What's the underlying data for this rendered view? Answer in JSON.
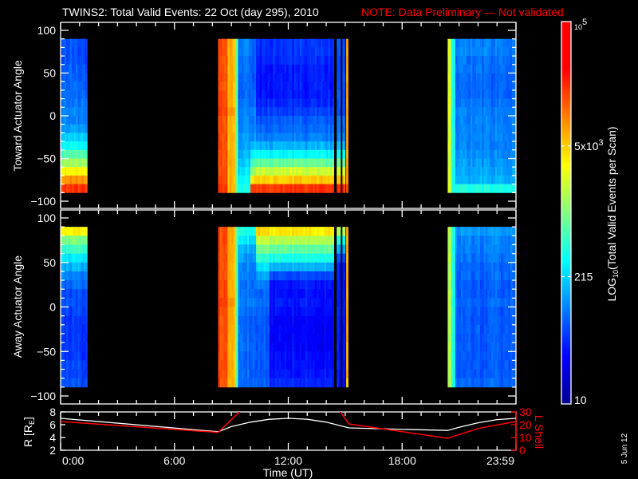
{
  "title": "TWINS2: Total Valid Events: 22 Oct (day 295), 2010",
  "note": "NOTE: Data Preliminary — Not validated",
  "date_stamp": "5 Jun 12",
  "colors": {
    "note": "#ff0000",
    "axis": "#ffffff",
    "lshell": "#ff0000",
    "radius": "#ffffff",
    "background": "#000000"
  },
  "chart_data": {
    "type": "heatmap",
    "x_range_hours": [
      0,
      24
    ],
    "x_ticks": [
      {
        "h": 0,
        "label": "0:00"
      },
      {
        "h": 6,
        "label": "6:00"
      },
      {
        "h": 12,
        "label": "12:00"
      },
      {
        "h": 18,
        "label": "18:00"
      },
      {
        "h": 24,
        "label": "23:59"
      }
    ],
    "xlabel": "Time (UT)",
    "angle_bins_deg": [
      85,
      75,
      65,
      55,
      45,
      35,
      25,
      15,
      5,
      -5,
      -15,
      -25,
      -35,
      -45,
      -55,
      -65,
      -75,
      -85
    ],
    "y_range": [
      -110,
      110
    ],
    "y_ticks": [
      "100",
      "50",
      "0",
      "−50",
      "−100"
    ],
    "y_tick_values": [
      100,
      50,
      0,
      -50,
      -100
    ],
    "value_units": "log10(Total Valid Events per Scan)",
    "panels": [
      {
        "ylabel": "Toward Actuator Angle",
        "columns": [
          {
            "t": [
              0,
              1.4
            ],
            "log_counts": [
              1.8,
              1.8,
              1.8,
              1.85,
              1.85,
              1.9,
              1.9,
              1.95,
              2.0,
              2.0,
              2.1,
              2.3,
              2.5,
              2.8,
              3.1,
              3.5,
              3.9,
              4.3
            ]
          },
          {
            "t": [
              8.3,
              8.8
            ],
            "log_counts": [
              4.2,
              4.2,
              4.2,
              4.2,
              4.2,
              4.2,
              4.2,
              4.2,
              4.25,
              4.2,
              4.2,
              4.2,
              4.2,
              4.2,
              4.2,
              4.2,
              4.2,
              4.3
            ]
          },
          {
            "t": [
              8.8,
              9.2
            ],
            "log_counts": [
              3.8,
              3.8,
              3.8,
              3.8,
              3.8,
              3.8,
              3.8,
              3.8,
              3.9,
              3.8,
              3.8,
              3.8,
              3.8,
              3.8,
              3.8,
              3.8,
              3.8,
              3.8
            ]
          },
          {
            "t": [
              9.2,
              9.35
            ],
            "log_counts": [
              2.9,
              2.9,
              2.9,
              2.9,
              2.9,
              2.9,
              2.9,
              2.9,
              2.9,
              2.9,
              2.9,
              2.9,
              2.9,
              2.9,
              2.9,
              2.9,
              2.9,
              2.9
            ]
          },
          {
            "t": [
              9.35,
              10.0
            ],
            "log_counts": [
              2.0,
              2.0,
              1.95,
              1.95,
              1.9,
              1.9,
              1.9,
              1.95,
              2.0,
              2.0,
              2.05,
              2.1,
              2.15,
              2.2,
              2.3,
              2.4,
              2.5,
              2.6
            ]
          },
          {
            "t": [
              10.0,
              10.3
            ],
            "log_counts": [
              1.9,
              1.9,
              1.85,
              1.85,
              1.85,
              1.85,
              1.9,
              1.9,
              2.0,
              2.0,
              2.05,
              2.1,
              2.2,
              2.5,
              2.8,
              3.1,
              3.6,
              4.3
            ]
          },
          {
            "t": [
              10.3,
              14.4
            ],
            "log_counts": [
              1.7,
              1.7,
              1.65,
              1.6,
              1.6,
              1.6,
              1.6,
              1.65,
              1.75,
              1.85,
              1.9,
              2.0,
              2.2,
              2.5,
              2.9,
              3.3,
              3.7,
              4.3
            ]
          },
          {
            "t": [
              14.55,
              14.75
            ],
            "log_counts": [
              1.8,
              1.8,
              1.8,
              1.8,
              1.8,
              1.8,
              1.8,
              1.8,
              1.8,
              1.9,
              1.9,
              2.0,
              2.2,
              2.5,
              2.9,
              3.3,
              3.7,
              4.3
            ]
          },
          {
            "t": [
              14.85,
              15.0
            ],
            "log_counts": [
              1.8,
              1.8,
              1.8,
              1.8,
              1.8,
              1.8,
              1.8,
              1.8,
              1.8,
              1.9,
              1.9,
              2.0,
              2.2,
              2.5,
              2.9,
              3.3,
              3.7,
              4.3
            ]
          },
          {
            "t": [
              15.05,
              15.15
            ],
            "log_counts": [
              3.8,
              3.8,
              3.8,
              3.8,
              3.8,
              3.8,
              3.8,
              3.8,
              3.8,
              3.8,
              3.8,
              3.8,
              3.8,
              3.8,
              3.8,
              3.8,
              3.8,
              4.2
            ]
          },
          {
            "t": [
              20.4,
              20.6
            ],
            "log_counts": [
              3.3,
              3.3,
              3.3,
              3.3,
              3.3,
              3.3,
              3.3,
              3.3,
              3.3,
              3.3,
              3.3,
              3.3,
              3.3,
              3.3,
              3.3,
              3.3,
              3.3,
              3.3
            ]
          },
          {
            "t": [
              20.6,
              20.8
            ],
            "log_counts": [
              2.6,
              2.6,
              2.6,
              2.6,
              2.6,
              2.6,
              2.6,
              2.6,
              2.6,
              2.6,
              2.6,
              2.6,
              2.6,
              2.6,
              2.6,
              2.6,
              2.6,
              2.6
            ]
          },
          {
            "t": [
              20.8,
              24.0
            ],
            "log_counts": [
              2.0,
              2.0,
              1.95,
              1.95,
              1.9,
              1.9,
              1.9,
              1.95,
              2.0,
              2.0,
              2.0,
              2.0,
              2.0,
              2.05,
              2.1,
              2.15,
              2.2,
              2.6
            ]
          }
        ]
      },
      {
        "ylabel": "Away Actuator Angle",
        "columns": [
          {
            "t": [
              0,
              1.4
            ],
            "log_counts": [
              3.5,
              3.0,
              2.7,
              2.4,
              2.2,
              2.0,
              1.9,
              1.8,
              1.8,
              1.75,
              1.7,
              1.7,
              1.7,
              1.7,
              1.7,
              1.75,
              1.75,
              1.8
            ]
          },
          {
            "t": [
              8.3,
              8.8
            ],
            "log_counts": [
              4.2,
              4.2,
              4.2,
              4.2,
              4.2,
              4.2,
              4.2,
              4.2,
              4.25,
              4.2,
              4.2,
              4.2,
              4.2,
              4.2,
              4.2,
              4.2,
              4.2,
              4.2
            ]
          },
          {
            "t": [
              8.8,
              9.2
            ],
            "log_counts": [
              3.8,
              3.8,
              3.8,
              3.8,
              3.8,
              3.8,
              3.8,
              3.8,
              3.9,
              3.8,
              3.8,
              3.8,
              3.8,
              3.8,
              3.8,
              3.8,
              3.8,
              3.8
            ]
          },
          {
            "t": [
              9.2,
              9.35
            ],
            "log_counts": [
              2.9,
              2.9,
              2.9,
              2.9,
              2.9,
              2.9,
              2.9,
              2.9,
              2.9,
              2.9,
              2.9,
              2.9,
              2.9,
              2.9,
              2.9,
              2.9,
              2.9,
              2.9
            ]
          },
          {
            "t": [
              9.35,
              10.3
            ],
            "log_counts": [
              2.6,
              2.4,
              2.2,
              2.1,
              2.0,
              2.0,
              1.95,
              1.95,
              2.0,
              1.95,
              1.9,
              1.9,
              1.9,
              1.9,
              1.9,
              1.9,
              1.9,
              1.9
            ]
          },
          {
            "t": [
              10.3,
              11.0
            ],
            "log_counts": [
              3.7,
              3.3,
              3.0,
              2.7,
              2.4,
              2.2,
              2.0,
              1.9,
              1.95,
              1.9,
              1.85,
              1.85,
              1.85,
              1.85,
              1.85,
              1.85,
              1.85,
              1.9
            ]
          },
          {
            "t": [
              11.0,
              14.4
            ],
            "log_counts": [
              3.6,
              3.2,
              2.9,
              2.6,
              2.2,
              1.8,
              1.6,
              1.55,
              1.6,
              1.55,
              1.5,
              1.5,
              1.5,
              1.5,
              1.55,
              1.55,
              1.6,
              1.65
            ]
          },
          {
            "t": [
              14.55,
              14.75
            ],
            "log_counts": [
              3.2,
              2.6,
              2.2,
              1.8,
              1.6,
              1.6,
              1.6,
              1.6,
              1.6,
              1.6,
              1.6,
              1.6,
              1.6,
              1.6,
              1.6,
              1.6,
              1.6,
              1.6
            ]
          },
          {
            "t": [
              14.85,
              15.0
            ],
            "log_counts": [
              3.2,
              2.6,
              2.2,
              1.8,
              1.6,
              1.6,
              1.6,
              1.6,
              1.6,
              1.6,
              1.6,
              1.6,
              1.6,
              1.6,
              1.6,
              1.6,
              1.6,
              1.6
            ]
          },
          {
            "t": [
              15.05,
              15.15
            ],
            "log_counts": [
              3.8,
              3.8,
              3.8,
              3.8,
              3.8,
              3.8,
              3.8,
              3.8,
              3.8,
              3.8,
              3.8,
              3.8,
              3.8,
              3.8,
              3.8,
              3.8,
              3.8,
              3.6
            ]
          },
          {
            "t": [
              20.4,
              20.6
            ],
            "log_counts": [
              3.2,
              3.2,
              3.2,
              3.2,
              3.2,
              3.2,
              3.2,
              3.2,
              3.2,
              3.2,
              3.2,
              3.2,
              3.2,
              3.2,
              3.2,
              3.2,
              3.2,
              3.2
            ]
          },
          {
            "t": [
              20.6,
              20.8
            ],
            "log_counts": [
              2.6,
              2.6,
              2.6,
              2.6,
              2.6,
              2.6,
              2.6,
              2.6,
              2.6,
              2.6,
              2.6,
              2.6,
              2.6,
              2.6,
              2.6,
              2.6,
              2.6,
              2.6
            ]
          },
          {
            "t": [
              20.8,
              24.0
            ],
            "log_counts": [
              2.1,
              2.0,
              2.0,
              1.95,
              1.9,
              1.9,
              1.85,
              1.85,
              1.9,
              1.85,
              1.85,
              1.85,
              1.85,
              1.85,
              1.85,
              1.85,
              1.85,
              1.9
            ]
          }
        ]
      }
    ],
    "colorbar": {
      "range_log10": [
        1,
        5
      ],
      "ticks": [
        {
          "log": 5,
          "base": "10",
          "exp": "5"
        },
        {
          "log": 3.699,
          "base": "5x10",
          "exp": "3"
        },
        {
          "log": 2.332,
          "base": "215",
          "exp": ""
        },
        {
          "log": 1,
          "base": "10",
          "exp": ""
        }
      ],
      "title_prefix": "LOG",
      "title_sub": "10",
      "title_rest": "(Total Valid Events per Scan)"
    },
    "orbit": {
      "type": "line",
      "r_axis": {
        "label": "R [R",
        "label_sub": "E",
        "label_end": "]",
        "range": [
          2,
          8
        ],
        "ticks": [
          "8",
          "6",
          "4",
          "2"
        ],
        "tick_values": [
          8,
          6,
          4,
          2
        ]
      },
      "l_axis": {
        "label": "L Shell",
        "range": [
          0,
          30
        ],
        "ticks": [
          "30",
          "20",
          "10",
          "0"
        ],
        "tick_values": [
          30,
          20,
          10,
          0
        ]
      },
      "r_series": [
        [
          0,
          7
        ],
        [
          8.3,
          4.9
        ],
        [
          9,
          5.7
        ],
        [
          10,
          6.4
        ],
        [
          11,
          6.85
        ],
        [
          12,
          7
        ],
        [
          13,
          6.85
        ],
        [
          14,
          6.4
        ],
        [
          15.2,
          5.5
        ],
        [
          20.4,
          5.1
        ],
        [
          21,
          5.6
        ],
        [
          22,
          6.3
        ],
        [
          23,
          6.8
        ],
        [
          24,
          7
        ]
      ],
      "l_series": [
        [
          0,
          22.5
        ],
        [
          8.3,
          14
        ],
        [
          9.5,
          31
        ],
        null,
        [
          14.7,
          31
        ],
        [
          15.2,
          20.6
        ],
        [
          20.4,
          9.4
        ],
        [
          22,
          17
        ],
        [
          24,
          22.5
        ]
      ]
    }
  }
}
